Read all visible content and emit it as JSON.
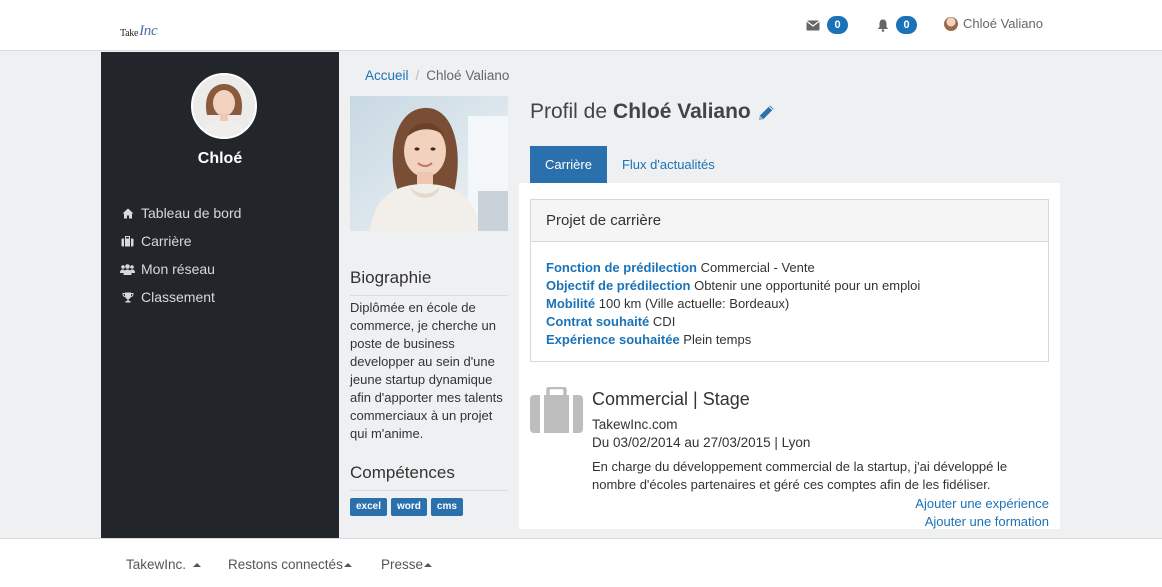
{
  "header": {
    "logo_text": "Take",
    "logo_script": "Inc",
    "mail_count": "0",
    "notif_count": "0",
    "user_name": "Chloé Valiano"
  },
  "sidebar": {
    "name": "Chloé",
    "items": [
      {
        "label": "Tableau de bord",
        "icon": "home-icon"
      },
      {
        "label": "Carrière",
        "icon": "briefcase-icon"
      },
      {
        "label": "Mon réseau",
        "icon": "users-icon"
      },
      {
        "label": "Classement",
        "icon": "trophy-icon"
      }
    ]
  },
  "breadcrumb": {
    "home": "Accueil",
    "current": "Chloé Valiano"
  },
  "left": {
    "bio_title": "Biographie",
    "bio_text": "Diplômée en école de commerce, je cherche un poste de business developper au sein d'une jeune startup dynamique afin d'apporter mes talents commerciaux à un projet qui m'anime.",
    "skills_title": "Compétences",
    "skills": [
      "excel",
      "word",
      "cms"
    ]
  },
  "profile": {
    "title_prefix": "Profil de",
    "name": "Chloé Valiano"
  },
  "tabs": [
    {
      "label": "Carrière",
      "active": true
    },
    {
      "label": "Flux d'actualités",
      "active": false
    }
  ],
  "career": {
    "panel_title": "Projet de carrière",
    "rows": [
      {
        "key": "Fonction de prédilection",
        "value": "Commercial - Vente"
      },
      {
        "key": "Objectif de prédilection",
        "value": "Obtenir une opportunité pour un emploi"
      },
      {
        "key": "Mobilité",
        "value": "100 km (Ville actuelle: Bordeaux)"
      },
      {
        "key": "Contrat souhaité",
        "value": "CDI"
      },
      {
        "key": "Expérience souhaitée",
        "value": "Plein temps"
      }
    ]
  },
  "experience": {
    "title": "Commercial | Stage",
    "company": "TakewInc.com",
    "dates": "Du 03/02/2014 au 27/03/2015 | Lyon",
    "description": "En charge du développement commercial de la startup, j'ai développé le nombre d'écoles partenaires et géré ces comptes afin de les fidéliser."
  },
  "actions": {
    "add_experience": "Ajouter une expérience",
    "add_formation": "Ajouter une formation"
  },
  "footer": {
    "items": [
      "TakewInc.",
      "Restons connectés",
      "Presse"
    ]
  },
  "colors": {
    "accent": "#1a73b8",
    "sidebar_bg": "#22262b",
    "tag_bg": "#2a70ad"
  }
}
